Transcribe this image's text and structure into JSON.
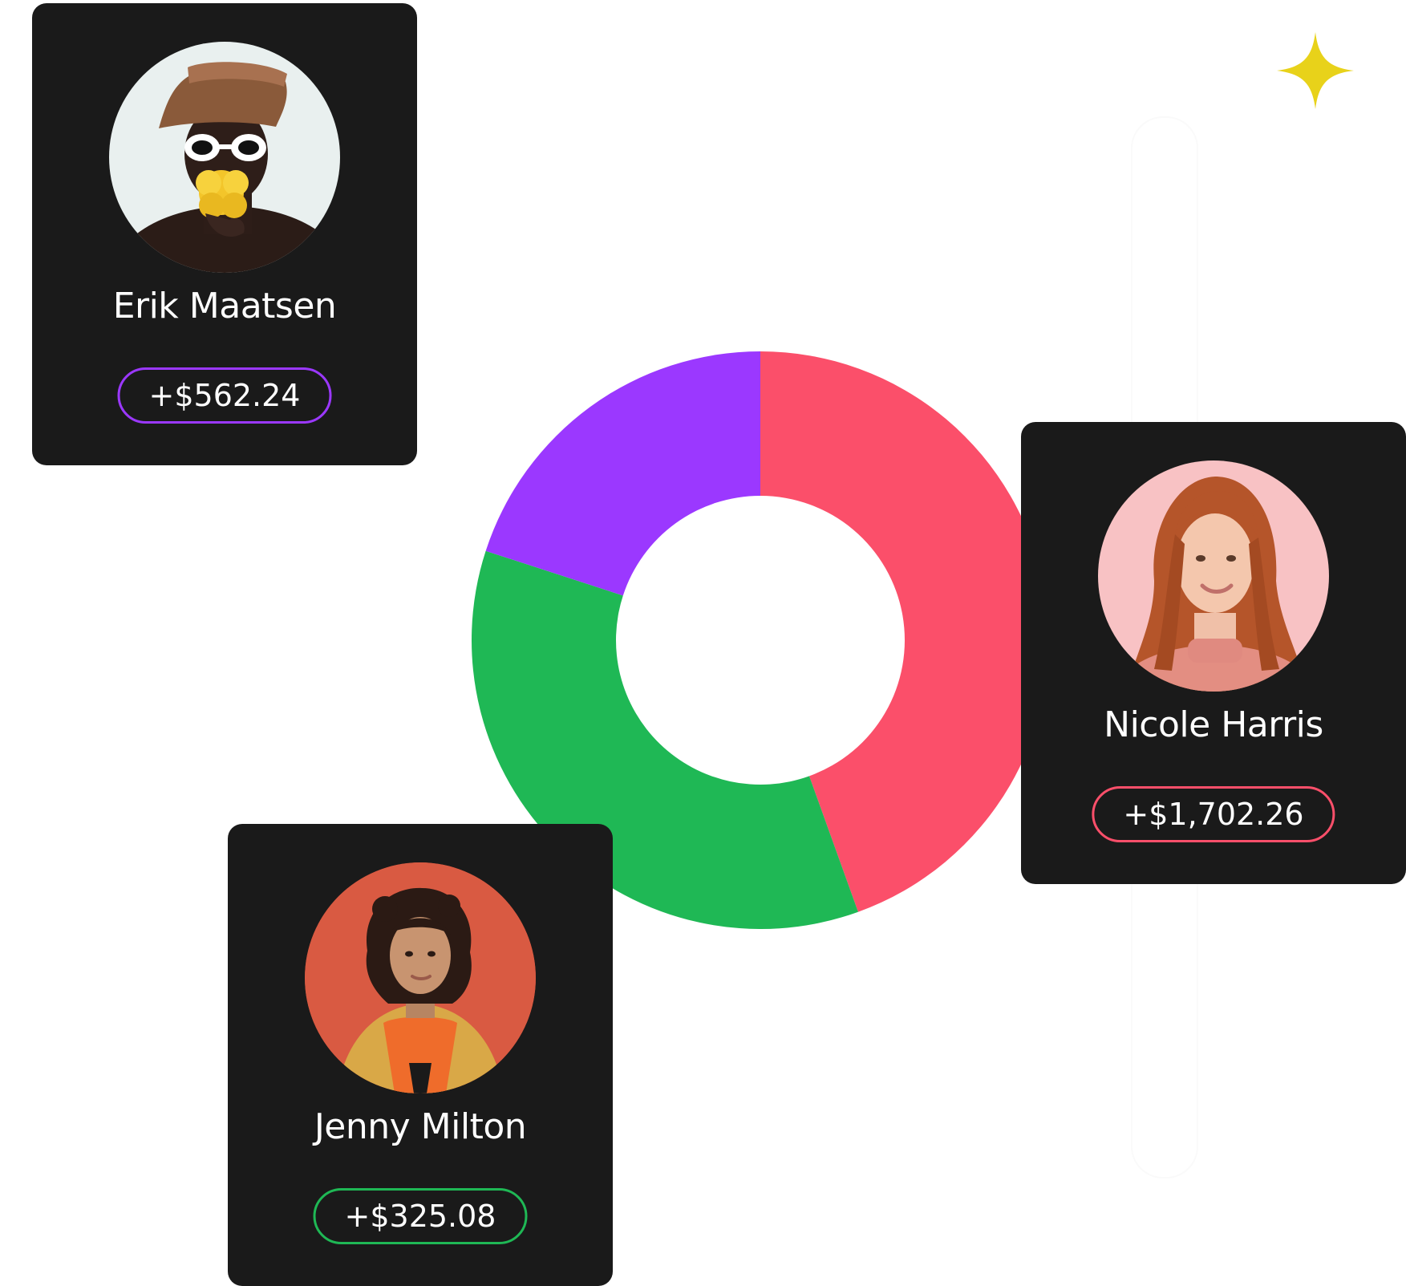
{
  "colors": {
    "card_bg": "#1a1a1a",
    "purple": "#9b38ff",
    "red": "#fb4f6a",
    "green": "#1fb855",
    "sparkle": "#e8d21a"
  },
  "cards": [
    {
      "name": "Erik Maatsen",
      "amount": "+$562.24",
      "accent": "#9b38ff",
      "avatar_icon": "person-with-flower-avatar"
    },
    {
      "name": "Nicole Harris",
      "amount": "+$1,702.26",
      "accent": "#fb4f6a",
      "avatar_icon": "red-haired-woman-avatar"
    },
    {
      "name": "Jenny Milton",
      "amount": "+$325.08",
      "accent": "#1fb855",
      "avatar_icon": "curly-haired-woman-avatar"
    }
  ],
  "chart_data": {
    "type": "pie",
    "donut": true,
    "series": [
      {
        "value": 44.5,
        "color": "#fb4f6a"
      },
      {
        "value": 35.5,
        "color": "#1fb855"
      },
      {
        "value": 20.0,
        "color": "#9b38ff"
      }
    ]
  },
  "decoration": {
    "sparkle_icon": "four-point-star-icon"
  }
}
